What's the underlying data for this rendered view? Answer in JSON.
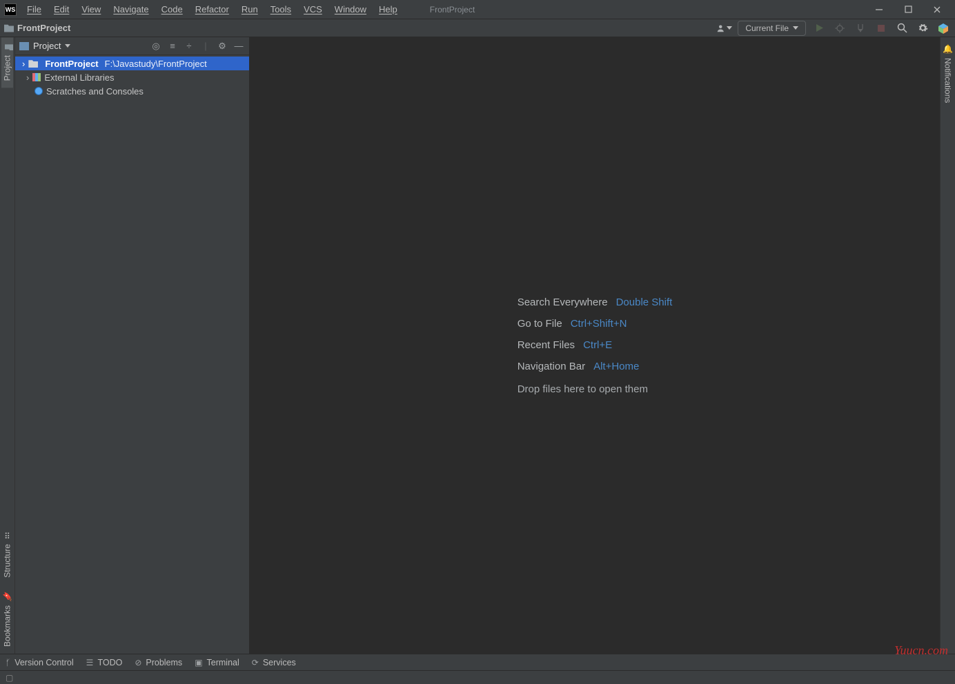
{
  "window": {
    "title": "FrontProject"
  },
  "menu": [
    "File",
    "Edit",
    "View",
    "Navigate",
    "Code",
    "Refactor",
    "Run",
    "Tools",
    "VCS",
    "Window",
    "Help"
  ],
  "nav": {
    "crumb": "FrontProject",
    "config_label": "Current File"
  },
  "left_gutter": {
    "project": "Project",
    "structure": "Structure",
    "bookmarks": "Bookmarks"
  },
  "right_gutter": {
    "notifications": "Notifications"
  },
  "project_panel": {
    "title": "Project",
    "tree": {
      "root_name": "FrontProject",
      "root_path": "F:\\Javastudy\\FrontProject",
      "ext_libs": "External Libraries",
      "scratches": "Scratches and Consoles"
    }
  },
  "welcome": {
    "rows": [
      {
        "label": "Search Everywhere",
        "shortcut": "Double Shift"
      },
      {
        "label": "Go to File",
        "shortcut": "Ctrl+Shift+N"
      },
      {
        "label": "Recent Files",
        "shortcut": "Ctrl+E"
      },
      {
        "label": "Navigation Bar",
        "shortcut": "Alt+Home"
      }
    ],
    "drop_text": "Drop files here to open them"
  },
  "status": {
    "version_control": "Version Control",
    "todo": "TODO",
    "problems": "Problems",
    "terminal": "Terminal",
    "services": "Services"
  },
  "watermark": "Yuucn.com",
  "icons": {
    "user": "user-icon",
    "run": "run-icon",
    "debug": "debug-icon",
    "coverage": "coverage-icon",
    "stop": "stop-icon",
    "search": "search-icon",
    "settings": "settings-icon",
    "cube": "cube-icon",
    "bell": "bell-icon"
  }
}
